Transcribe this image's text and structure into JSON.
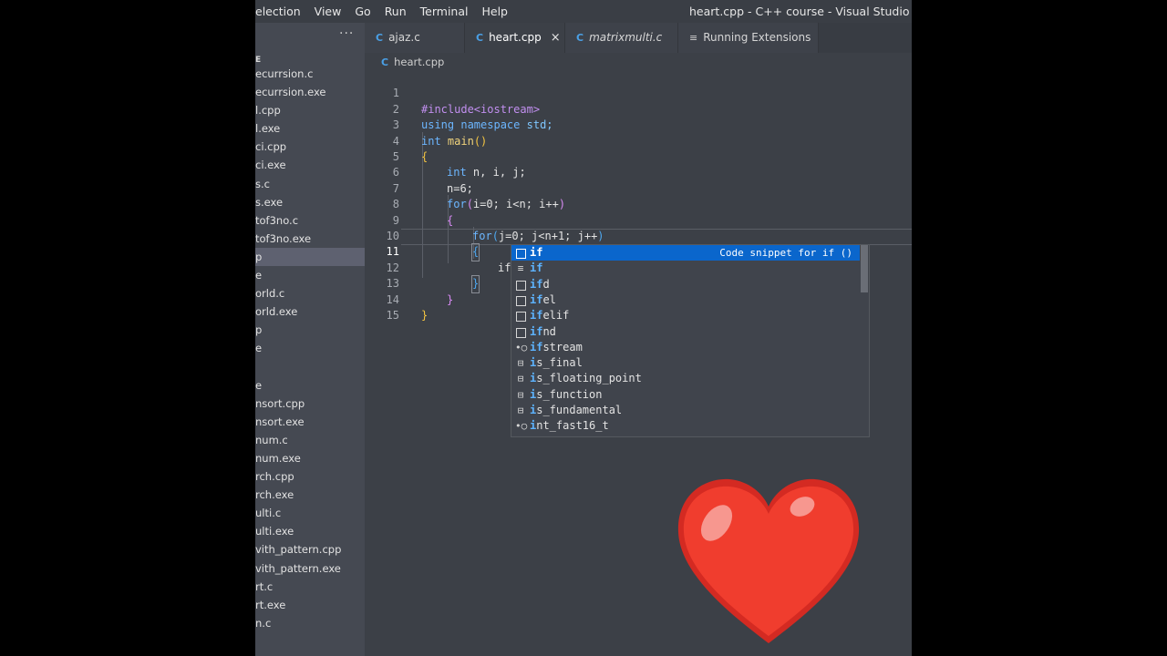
{
  "menu": [
    "election",
    "View",
    "Go",
    "Run",
    "Terminal",
    "Help"
  ],
  "window_title": "heart.cpp - C++ course - Visual Studio Code",
  "sidebar": {
    "more": "···",
    "header": "E",
    "files": [
      "ecurrsion.c",
      "ecurrsion.exe",
      "l.cpp",
      "l.exe",
      "ci.cpp",
      "ci.exe",
      "s.c",
      "s.exe",
      "tof3no.c",
      "tof3no.exe",
      "p",
      "e",
      "orld.c",
      "orld.exe",
      "p",
      "e",
      "",
      "e",
      "nsort.cpp",
      "nsort.exe",
      "num.c",
      "num.exe",
      "rch.cpp",
      "rch.exe",
      "ulti.c",
      "ulti.exe",
      "vith_pattern.cpp",
      "vith_pattern.exe",
      "rt.c",
      "rt.exe",
      "n.c"
    ]
  },
  "tabs": [
    {
      "label": "ajaz.c",
      "icon": "C"
    },
    {
      "label": "heart.cpp",
      "icon": "C",
      "close": "×"
    },
    {
      "label": "matrixmulti.c",
      "icon": "C"
    },
    {
      "label": "Running Extensions",
      "icon": "≡"
    }
  ],
  "breadcrumb": "heart.cpp",
  "editor": {
    "line_numbers": [
      "1",
      "2",
      "3",
      "4",
      "5",
      "6",
      "7",
      "8",
      "9",
      "10",
      "11",
      "12",
      "13",
      "14",
      "15"
    ],
    "lines": {
      "l1": "#include<iostream>",
      "l2a": "using",
      "l2b": "namespace",
      "l2c": "std;",
      "l3a": "int",
      "l3b": "main",
      "l3c": "()",
      "l4": "{",
      "l5a": "int",
      "l5b": "n, i, j;",
      "l6": "n=6;",
      "l7a": "for",
      "l7b": "(",
      "l7c": "i=0; i<n; i++",
      "l7d": ")",
      "l8": "{",
      "l9a": "for",
      "l9b": "(",
      "l9c": "j=0; j<n+1; j++",
      "l9d": ")",
      "l10": "{",
      "l11": "if",
      "l12": "}",
      "l13": "}",
      "l14": "}"
    }
  },
  "suggest": {
    "detail": "Code snippet for if ()",
    "items": [
      {
        "m": "if",
        "rest": "",
        "icon": "box"
      },
      {
        "m": "if",
        "rest": "",
        "icon": "≡"
      },
      {
        "m": "if",
        "rest": "d",
        "icon": "box"
      },
      {
        "m": "if",
        "rest": "el",
        "icon": "box"
      },
      {
        "m": "if",
        "rest": "elif",
        "icon": "box"
      },
      {
        "m": "if",
        "rest": "nd",
        "icon": "box"
      },
      {
        "m": "if",
        "rest": "stream",
        "icon": "•○"
      },
      {
        "m": "i",
        "rest": "s_final",
        "icon": "⊟"
      },
      {
        "m": "i",
        "rest": "s_floating_point",
        "icon": "⊟"
      },
      {
        "m": "i",
        "rest": "s_function",
        "icon": "⊟"
      },
      {
        "m": "i",
        "rest": "s_fundamental",
        "icon": "⊟"
      },
      {
        "m": "i",
        "rest": "nt_fast16_t",
        "icon": "•○"
      }
    ]
  }
}
